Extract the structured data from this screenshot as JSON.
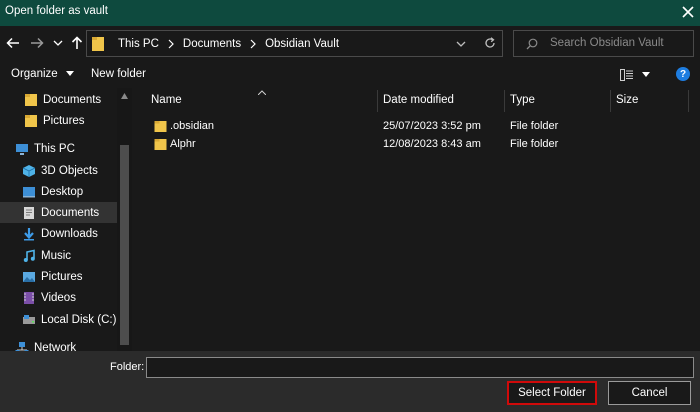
{
  "window": {
    "title": "Open folder as vault"
  },
  "nav": {
    "back": "back-arrow",
    "forward": "forward-arrow",
    "recent": "chevron-down",
    "up": "up-arrow"
  },
  "address": {
    "crumbs": [
      "This PC",
      "Documents",
      "Obsidian Vault"
    ]
  },
  "search": {
    "placeholder": "Search Obsidian Vault"
  },
  "toolbar": {
    "organize": "Organize",
    "new_folder": "New folder",
    "help": "?"
  },
  "sidebar": {
    "items": [
      {
        "label": "Documents",
        "icon": "folder-icon"
      },
      {
        "label": "Pictures",
        "icon": "folder-icon"
      },
      {
        "label": "This PC",
        "icon": "computer-icon"
      },
      {
        "label": "3D Objects",
        "icon": "cube-icon"
      },
      {
        "label": "Desktop",
        "icon": "desktop-icon"
      },
      {
        "label": "Documents",
        "icon": "documents-icon",
        "selected": true
      },
      {
        "label": "Downloads",
        "icon": "downloads-icon"
      },
      {
        "label": "Music",
        "icon": "music-icon"
      },
      {
        "label": "Pictures",
        "icon": "pictures-icon"
      },
      {
        "label": "Videos",
        "icon": "videos-icon"
      },
      {
        "label": "Local Disk (C:)",
        "icon": "disk-icon"
      },
      {
        "label": "Network",
        "icon": "network-icon"
      }
    ]
  },
  "columns": {
    "name": "Name",
    "date": "Date modified",
    "type": "Type",
    "size": "Size"
  },
  "files": [
    {
      "name": ".obsidian",
      "date": "25/07/2023 3:52 pm",
      "type": "File folder"
    },
    {
      "name": "Alphr",
      "date": "12/08/2023 8:43 am",
      "type": "File folder"
    }
  ],
  "footer": {
    "folder_label": "Folder:",
    "folder_value": "",
    "select_label": "Select Folder",
    "cancel_label": "Cancel"
  },
  "colors": {
    "title_bar": "#0e4a3e",
    "background": "#191919",
    "footer": "#2b2b2b",
    "highlight": "#d00a0a",
    "folder": "#f0c54a"
  }
}
